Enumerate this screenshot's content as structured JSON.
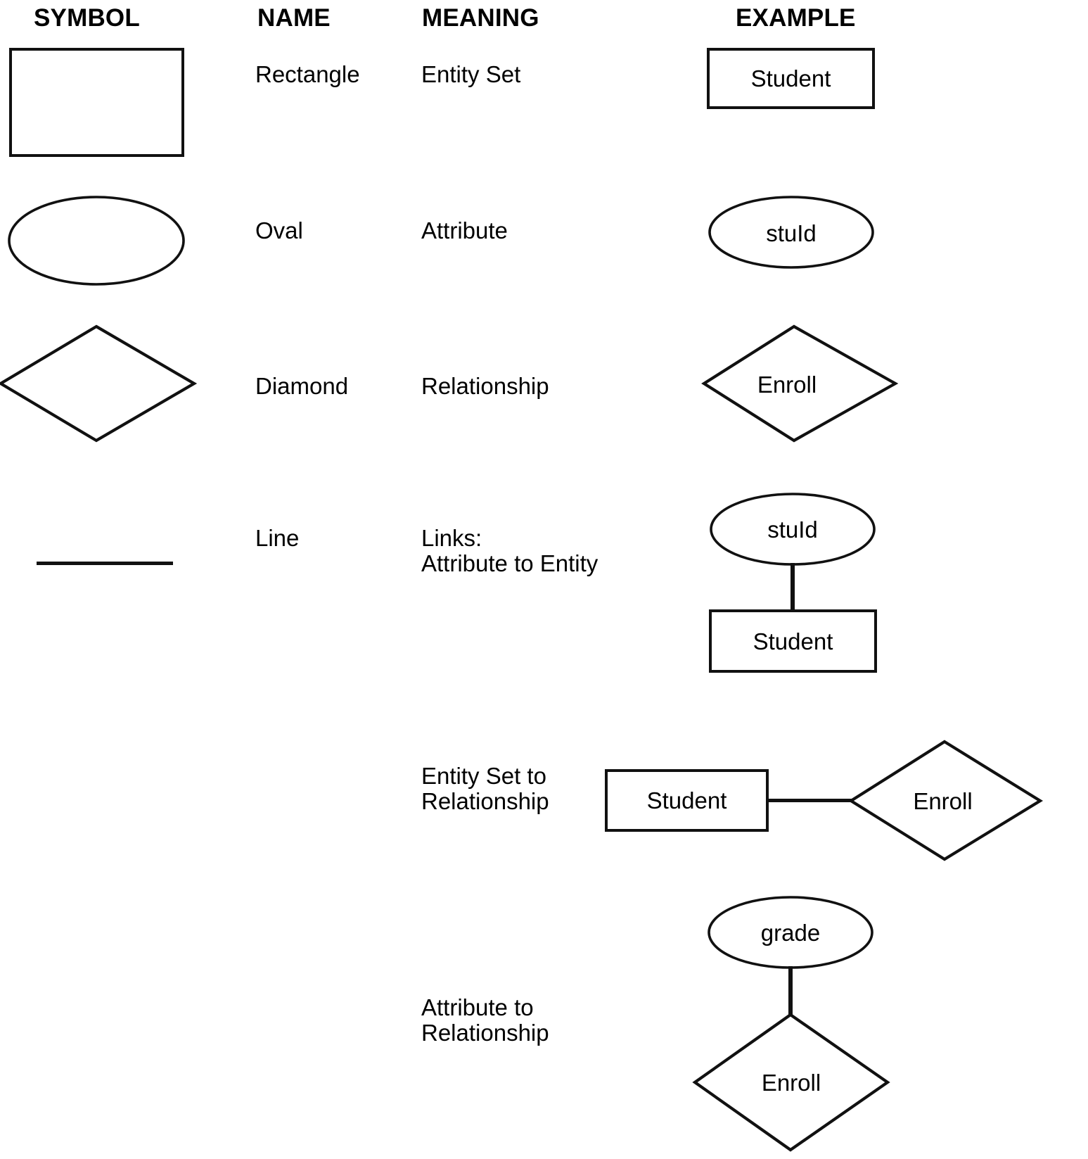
{
  "headers": {
    "symbol": "SYMBOL",
    "name": "NAME",
    "meaning": "MEANING",
    "example": "EXAMPLE"
  },
  "rows": [
    {
      "name": "Rectangle",
      "meaning": "Entity Set",
      "symbol_shape": "rectangle",
      "example_labels": [
        "Student"
      ]
    },
    {
      "name": "Oval",
      "meaning": "Attribute",
      "symbol_shape": "oval",
      "example_labels": [
        "stuId"
      ]
    },
    {
      "name": "Diamond",
      "meaning": "Relationship",
      "symbol_shape": "diamond",
      "example_labels": [
        "Enroll"
      ]
    },
    {
      "name": "Line",
      "meaning": "Links:\nAttribute to Entity",
      "symbol_shape": "line",
      "example_labels": [
        "stuId",
        "Student"
      ]
    },
    {
      "name": "",
      "meaning": "Entity Set to\nRelationship",
      "symbol_shape": "none",
      "example_labels": [
        "Student",
        "Enroll"
      ]
    },
    {
      "name": "",
      "meaning": "Attribute to\nRelationship",
      "symbol_shape": "none",
      "example_labels": [
        "grade",
        "Enroll"
      ]
    }
  ],
  "colors": {
    "stroke": "#111111",
    "background": "#ffffff",
    "text": "#000000"
  }
}
